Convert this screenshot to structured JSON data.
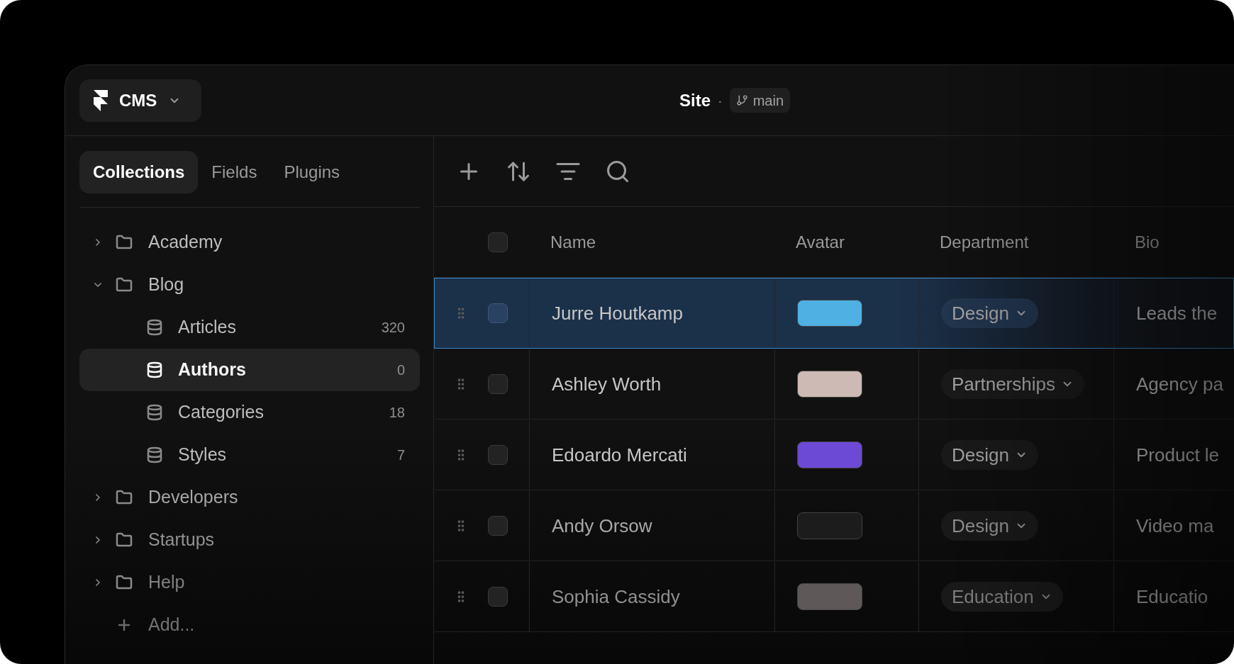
{
  "top_bar": {
    "app_menu": "CMS",
    "site": "Site",
    "separator": "·",
    "branch": "main"
  },
  "sidebar": {
    "tabs": [
      {
        "label": "Collections",
        "selected": true
      },
      {
        "label": "Fields",
        "selected": false
      },
      {
        "label": "Plugins",
        "selected": false
      }
    ],
    "tree": [
      {
        "label": "Academy",
        "expanded": false,
        "selected": false
      },
      {
        "label": "Blog",
        "expanded": true,
        "selected": false,
        "children": [
          {
            "label": "Articles",
            "count": "320",
            "selected": false
          },
          {
            "label": "Authors",
            "count": "0",
            "selected": true
          },
          {
            "label": "Categories",
            "count": "18",
            "selected": false
          },
          {
            "label": "Styles",
            "count": "7",
            "selected": false
          }
        ]
      },
      {
        "label": "Developers",
        "expanded": false,
        "selected": false
      },
      {
        "label": "Startups",
        "expanded": false,
        "selected": false
      },
      {
        "label": "Help",
        "expanded": false,
        "selected": false
      }
    ],
    "add_label": "Add..."
  },
  "table": {
    "header_checkbox": {
      "checked": false
    },
    "columns": [
      {
        "label": "Name"
      },
      {
        "label": "Avatar"
      },
      {
        "label": "Department"
      },
      {
        "label": "Bio"
      }
    ],
    "rows": [
      {
        "name": "Jurre Houtkamp",
        "avatar": {
          "color": "#4fb0e4"
        },
        "department": "Design",
        "bio": "Leads the",
        "selected": true,
        "checked": false
      },
      {
        "name": "Ashley Worth",
        "avatar": {
          "color": "#cdbab4"
        },
        "department": "Partnerships",
        "bio": "Agency pa",
        "selected": false,
        "checked": false
      },
      {
        "name": "Edoardo Mercati",
        "avatar": {
          "color": "#6d4ad6"
        },
        "department": "Design",
        "bio": "Product le",
        "selected": false,
        "checked": false
      },
      {
        "name": "Andy Orsow",
        "avatar": {
          "color": "#1c1c1c"
        },
        "department": "Design",
        "bio": "Video ma",
        "selected": false,
        "checked": false
      },
      {
        "name": "Sophia Cassidy",
        "avatar": {
          "color": "#5e5858"
        },
        "department": "Education",
        "bio": "Educatio",
        "selected": false,
        "checked": false
      }
    ]
  }
}
